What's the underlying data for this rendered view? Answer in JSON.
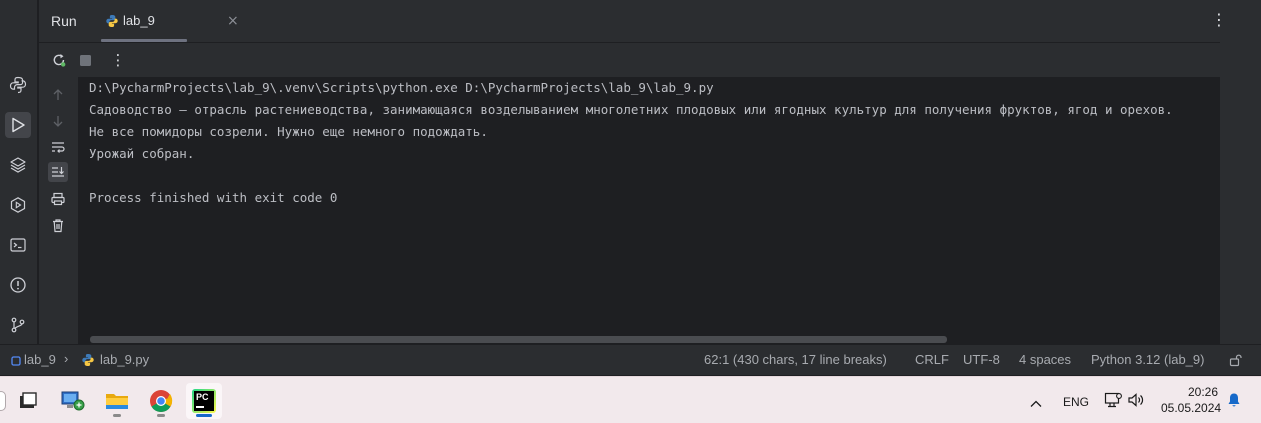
{
  "tool_window": {
    "title": "Run",
    "tab": {
      "label": "lab_9",
      "close": "×"
    },
    "more_glyph": "⋮"
  },
  "toolbar": {
    "more_glyph": "⋮"
  },
  "console": {
    "lines": [
      "D:\\PycharmProjects\\lab_9\\.venv\\Scripts\\python.exe D:\\PycharmProjects\\lab_9\\lab_9.py",
      "Садоводство — отрасль растениеводства, занимающаяся возделыванием многолетних плодовых или ягодных культур для получения фруктов, ягод и орехов.",
      "Не все помидоры созрели. Нужно еще немного подождать.",
      "Урожай собран.",
      "",
      "Process finished with exit code 0"
    ]
  },
  "statusbar": {
    "project": "lab_9",
    "file": "lab_9.py",
    "caret": "62:1 (430 chars, 17 line breaks)",
    "line_sep": "CRLF",
    "encoding": "UTF-8",
    "indent": "4 spaces",
    "interpreter": "Python 3.12 (lab_9)"
  },
  "taskbar": {
    "lang": "ENG",
    "time": "20:26",
    "date": "05.05.2024",
    "pycharm_badge": "PC"
  },
  "colors": {
    "accent_blue": "#3574f0",
    "run_green": "#5fb865",
    "python_blue": "#3d7ab8",
    "python_yellow": "#f6c744"
  }
}
